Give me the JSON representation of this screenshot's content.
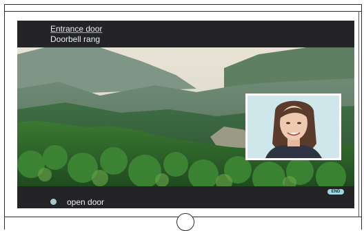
{
  "header": {
    "caller_name": "Entrance door",
    "event": "Doorbell rang"
  },
  "camera": {
    "main_view": "landscape-camera-feed",
    "pip_view": "visitor-face"
  },
  "footer": {
    "open_door_label": "open door",
    "end_label": "END"
  },
  "colors": {
    "screen_bg": "#242427",
    "accent": "#9fd7e1",
    "text": "#e8f1f2"
  }
}
